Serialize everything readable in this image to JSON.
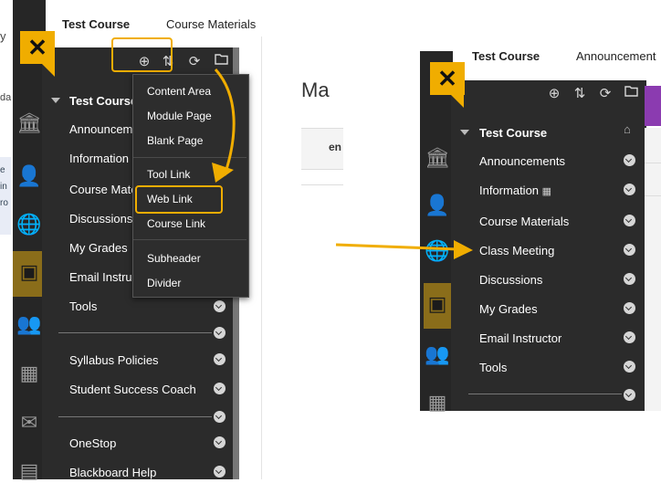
{
  "left": {
    "breadcrumb": [
      "Test Course",
      "Course Materials"
    ],
    "edge_text": [
      "y",
      "da",
      "e",
      "in",
      "ro"
    ],
    "content_title_fragment": "Ma",
    "content_fragment_2": "en",
    "course_title": "Test Course",
    "menu_items": [
      "Announcements",
      "Information",
      "Course Materials",
      "Discussions",
      "My Grades",
      "Email Instructor",
      "Tools"
    ],
    "section2_items": [
      "Syllabus Policies",
      "Student Success Coach"
    ],
    "section3_items": [
      "OneStop",
      "Blackboard Help"
    ],
    "dropdown": [
      "Content Area",
      "Module Page",
      "Blank Page",
      "Tool Link",
      "Web Link",
      "Course Link",
      "Subheader",
      "Divider"
    ]
  },
  "right": {
    "breadcrumb": [
      "Test Course",
      "Announcement"
    ],
    "course_title": "Test Course",
    "menu_items": [
      "Announcements",
      "Information",
      "Course Materials",
      "Class Meeting",
      "Discussions",
      "My Grades",
      "Email Instructor",
      "Tools"
    ],
    "information_badge": "▦"
  },
  "icons": {
    "close": "✕",
    "add": "⊕",
    "reorder": "⇅",
    "refresh": "⟳",
    "folder": "▭",
    "home": "⌂"
  },
  "colors": {
    "accent": "#f0ad00",
    "panel": "#2b2b2b",
    "rail": "#262626"
  }
}
